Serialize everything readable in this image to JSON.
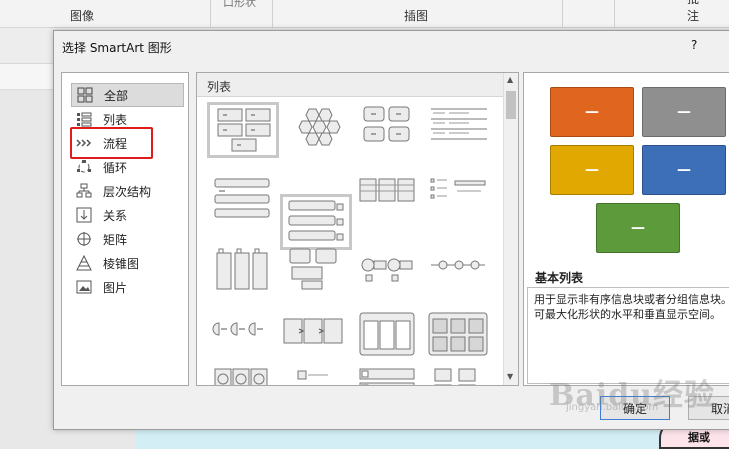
{
  "ribbon": {
    "group_image": "图像",
    "group_illustration": "插图",
    "group_comment": "批注",
    "ghost_top": "口形状"
  },
  "dialog": {
    "title": "选择 SmartArt 图形",
    "help": "?",
    "categories": [
      {
        "label": "全部",
        "icon": "all-grid-icon",
        "selected": true
      },
      {
        "label": "列表",
        "icon": "list-icon"
      },
      {
        "label": "流程",
        "icon": "process-arrows-icon"
      },
      {
        "label": "循环",
        "icon": "cycle-icon"
      },
      {
        "label": "层次结构",
        "icon": "hierarchy-icon"
      },
      {
        "label": "关系",
        "icon": "relationship-icon"
      },
      {
        "label": "矩阵",
        "icon": "matrix-icon"
      },
      {
        "label": "棱锥图",
        "icon": "pyramid-icon"
      },
      {
        "label": "图片",
        "icon": "picture-icon"
      }
    ],
    "gallery_header": "列表",
    "preview": {
      "name": "基本列表",
      "description": "用于显示非有序信息块或者分组信息块。可最大化形状的水平和垂直显示空间。",
      "dash": "—",
      "colors": [
        "#e0651f",
        "#8f8f8f",
        "#e0a800",
        "#3d6eb8",
        "#5d9a3c"
      ]
    },
    "ok_label": "确定",
    "cancel_label": "取消"
  },
  "bubble_text": "相同数据或",
  "watermark": "Baidu经验",
  "watermark_sub": "jingyan.baidu.com"
}
